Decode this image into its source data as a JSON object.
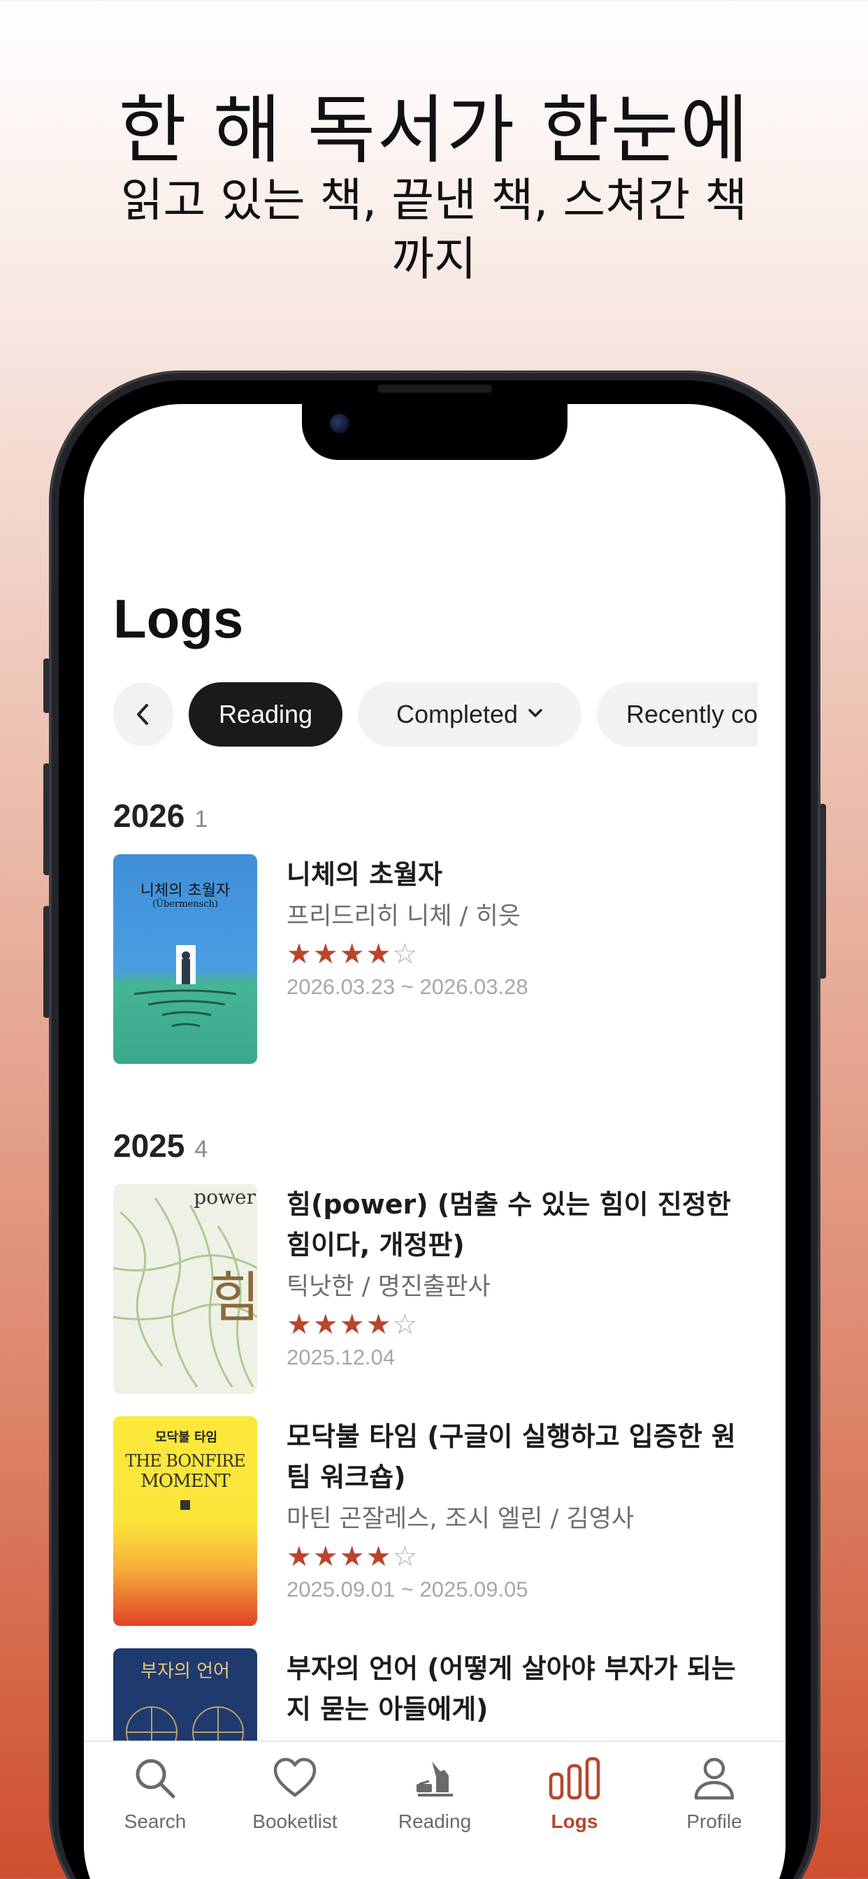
{
  "promo": {
    "headline": "한 해 독서가 한눈에",
    "subline": "읽고 있는 책, 끝낸 책, 스쳐간 책까지"
  },
  "screen": {
    "title": "Logs",
    "chips": {
      "back_icon": "chevron-left-icon",
      "reading": "Reading",
      "completed": "Completed",
      "recent": "Recently co"
    },
    "sections": [
      {
        "year": "2026",
        "count": "1",
        "books": [
          {
            "title": "니체의 초월자",
            "author": "프리드리히 니체 / 히읏",
            "rating": 4,
            "date": "2026.03.23 ~ 2026.03.28",
            "cover": {
              "title": "니체의 초월자",
              "subtitle": "(Übermensch)"
            }
          }
        ]
      },
      {
        "year": "2025",
        "count": "4",
        "books": [
          {
            "title": "힘(power) (멈출 수 있는 힘이 진정한 힘이다, 개정판)",
            "author": "틱낫한 / 명진출판사",
            "rating": 4,
            "date": "2025.12.04",
            "cover": {
              "title": "power",
              "big": "힘"
            }
          },
          {
            "title": "모닥불 타임 (구글이 실행하고 입증한 원팀 워크숍)",
            "author": "마틴 곤잘레스, 조시 엘린 / 김영사",
            "rating": 4,
            "date": "2025.09.01 ~ 2025.09.05",
            "cover": {
              "title": "모닥불 타임",
              "en1": "THE BONFIRE",
              "en2": "MOMENT"
            }
          },
          {
            "title": "부자의 언어 (어떻게 살아야 부자가 되는지 묻는 아들에게)",
            "cover": {
              "title": "부자의 언어"
            }
          }
        ]
      }
    ]
  },
  "tabbar": {
    "tabs": [
      {
        "label": "Search",
        "icon": "search-icon"
      },
      {
        "label": "Booketlist",
        "icon": "heart-icon"
      },
      {
        "label": "Reading",
        "icon": "reading-dog-icon"
      },
      {
        "label": "Logs",
        "icon": "bar-chart-icon",
        "active": true
      },
      {
        "label": "Profile",
        "icon": "person-icon"
      }
    ]
  },
  "colors": {
    "accent": "#b8452c",
    "chip_active": "#1a1a1a",
    "chip": "#f2f2f2"
  }
}
